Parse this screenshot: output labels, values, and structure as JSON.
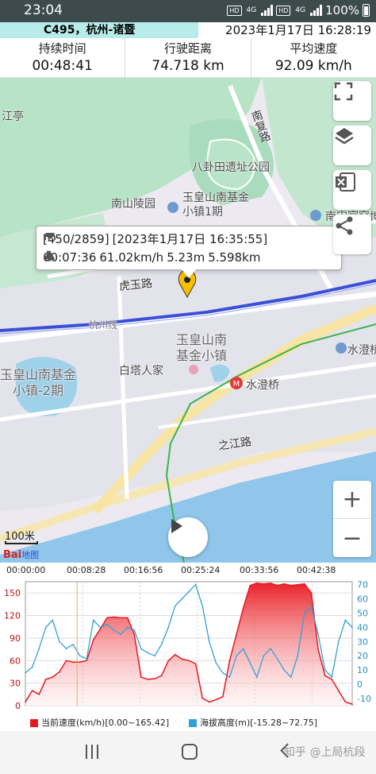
{
  "status_bar": {
    "time": "23:04",
    "hd1": "HD",
    "net1": "4G",
    "hd2": "HD",
    "net2": "4G",
    "battery": "100%"
  },
  "trip": {
    "name": "C495，杭州-诸暨",
    "datetime": "2023年1月17日 16:28:19"
  },
  "stats": [
    {
      "label": "持续时间",
      "value": "00:48:41"
    },
    {
      "label": "行驶距离",
      "value": "74.718 km"
    },
    {
      "label": "平均速度",
      "value": "92.09 km/h"
    }
  ],
  "map": {
    "labels": {
      "jiangting": "江亭",
      "nanfu_road": "南复路",
      "bagua": "八卦田遗址公园",
      "nanshan_cemetery": "南山陵园",
      "yuhuang_town1": "玉皇山南基金\n小镇1期",
      "nanshou": "南宋官窑博",
      "huyu_road": "虎玉路",
      "hang_line": "杭州线",
      "yuhuang_center": "玉皇山南\n基金小镇",
      "baita": "白塔人家",
      "shuicheng_bridge": "水澄桥",
      "shuicheng_station": "水澄桥",
      "yuhuang_town2": "玉皇山南基金\n小镇-2期",
      "zhijiang_road": "之江路"
    },
    "scale": "100米",
    "baidu": "Bai",
    "baidu_sub": "地图",
    "zoom_in": "+",
    "zoom_out": "−"
  },
  "popup": {
    "index": "[450/2859]",
    "datetime": "[2023年1月17日 16:35:55]",
    "elapsed": "00:07:36",
    "speed": "61.02km/h",
    "altitude": "5.23m",
    "distance": "5.598km"
  },
  "timeline": [
    "00:00:00",
    "00:08:28",
    "00:16:56",
    "00:25:24",
    "00:33:56",
    "00:42:38"
  ],
  "chart_data": {
    "type": "area",
    "x": [
      0,
      1,
      2,
      3,
      4,
      5,
      6,
      7,
      8,
      9,
      10,
      11,
      12,
      13,
      14,
      15,
      16,
      17,
      18,
      19,
      20,
      21,
      22,
      23,
      24,
      25,
      26,
      27,
      28,
      29,
      30,
      31,
      32,
      33,
      34,
      35,
      36,
      37,
      38,
      39,
      40,
      41,
      42,
      43,
      44,
      45,
      46,
      47,
      48
    ],
    "series": [
      {
        "name": "当前速度(km/h)[0.00~165.42]",
        "axis": "left",
        "color": "#e8181f",
        "values": [
          5,
          20,
          15,
          35,
          38,
          45,
          60,
          58,
          58,
          60,
          88,
          102,
          117,
          118,
          117,
          117,
          95,
          38,
          35,
          36,
          40,
          60,
          68,
          62,
          60,
          56,
          10,
          5,
          8,
          12,
          60,
          95,
          130,
          160,
          163,
          162,
          163,
          160,
          162,
          160,
          161,
          162,
          150,
          75,
          40,
          35,
          20,
          5,
          2
        ]
      },
      {
        "name": "海拔高度(m)[-15.28~72.75]",
        "axis": "right",
        "color": "#30a0d8",
        "values": [
          8,
          12,
          25,
          40,
          45,
          30,
          25,
          28,
          20,
          18,
          45,
          40,
          42,
          38,
          35,
          40,
          38,
          25,
          22,
          20,
          28,
          40,
          55,
          60,
          65,
          70,
          55,
          30,
          15,
          8,
          5,
          20,
          25,
          15,
          5,
          20,
          25,
          18,
          10,
          5,
          20,
          50,
          55,
          35,
          10,
          5,
          30,
          45,
          40
        ]
      }
    ],
    "left_ticks": [
      0,
      30,
      60,
      90,
      120,
      150
    ],
    "right_ticks": [
      -10,
      0,
      10,
      20,
      30,
      40,
      50,
      60,
      70
    ],
    "ylim_left": [
      0,
      165
    ],
    "ylim_right": [
      -15,
      72
    ],
    "cursor_x": 7.6
  },
  "legend": {
    "speed": "当前速度(km/h)[0.00~165.42]",
    "altitude": "海拔高度(m)[-15.28~72.75]"
  },
  "watermark": "知乎 @上局杭段"
}
